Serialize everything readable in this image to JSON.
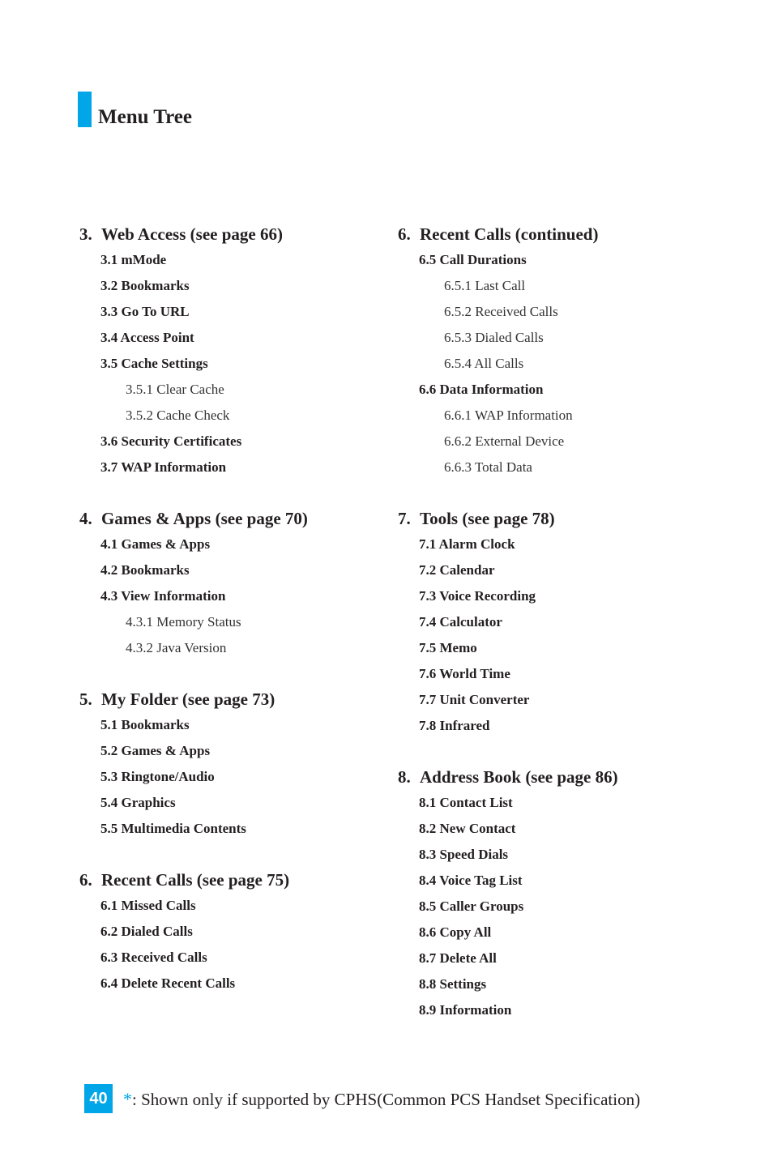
{
  "header": {
    "title": "Menu Tree",
    "accent_color": "#00a6e8"
  },
  "columns": [
    {
      "sections": [
        {
          "num": "3.",
          "label": "Web Access (see page 66)",
          "items": [
            {
              "level": 2,
              "label": "3.1 mMode"
            },
            {
              "level": 2,
              "label": "3.2 Bookmarks"
            },
            {
              "level": 2,
              "label": "3.3 Go To URL"
            },
            {
              "level": 2,
              "label": "3.4 Access Point"
            },
            {
              "level": 2,
              "label": "3.5 Cache Settings"
            },
            {
              "level": 3,
              "label": "3.5.1 Clear Cache"
            },
            {
              "level": 3,
              "label": "3.5.2 Cache Check"
            },
            {
              "level": 2,
              "label": "3.6 Security Certificates"
            },
            {
              "level": 2,
              "label": "3.7 WAP Information"
            }
          ]
        },
        {
          "num": "4.",
          "label": "Games & Apps (see page 70)",
          "items": [
            {
              "level": 2,
              "label": "4.1 Games & Apps"
            },
            {
              "level": 2,
              "label": "4.2 Bookmarks"
            },
            {
              "level": 2,
              "label": "4.3 View Information"
            },
            {
              "level": 3,
              "label": "4.3.1 Memory Status"
            },
            {
              "level": 3,
              "label": "4.3.2 Java Version"
            }
          ]
        },
        {
          "num": "5.",
          "label": "My Folder (see page 73)",
          "items": [
            {
              "level": 2,
              "label": "5.1 Bookmarks"
            },
            {
              "level": 2,
              "label": "5.2 Games & Apps"
            },
            {
              "level": 2,
              "label": "5.3 Ringtone/Audio"
            },
            {
              "level": 2,
              "label": "5.4 Graphics"
            },
            {
              "level": 2,
              "label": "5.5 Multimedia Contents"
            }
          ]
        },
        {
          "num": "6.",
          "label": "Recent Calls (see page 75)",
          "items": [
            {
              "level": 2,
              "label": "6.1 Missed Calls"
            },
            {
              "level": 2,
              "label": "6.2 Dialed Calls"
            },
            {
              "level": 2,
              "label": "6.3 Received Calls"
            },
            {
              "level": 2,
              "label": "6.4 Delete Recent Calls"
            }
          ]
        }
      ]
    },
    {
      "sections": [
        {
          "num": "6.",
          "label": "Recent Calls (continued)",
          "items": [
            {
              "level": 2,
              "label": "6.5 Call Durations"
            },
            {
              "level": 3,
              "label": "6.5.1 Last Call"
            },
            {
              "level": 3,
              "label": "6.5.2 Received Calls"
            },
            {
              "level": 3,
              "label": "6.5.3 Dialed Calls"
            },
            {
              "level": 3,
              "label": "6.5.4 All Calls"
            },
            {
              "level": 2,
              "label": "6.6 Data Information"
            },
            {
              "level": 3,
              "label": "6.6.1 WAP Information"
            },
            {
              "level": 3,
              "label": "6.6.2 External Device"
            },
            {
              "level": 3,
              "label": "6.6.3 Total Data"
            }
          ]
        },
        {
          "num": "7.",
          "label": "Tools (see page 78)",
          "items": [
            {
              "level": 2,
              "label": "7.1 Alarm Clock"
            },
            {
              "level": 2,
              "label": "7.2 Calendar"
            },
            {
              "level": 2,
              "label": "7.3 Voice Recording"
            },
            {
              "level": 2,
              "label": "7.4 Calculator"
            },
            {
              "level": 2,
              "label": "7.5 Memo"
            },
            {
              "level": 2,
              "label": "7.6 World Time"
            },
            {
              "level": 2,
              "label": "7.7 Unit Converter"
            },
            {
              "level": 2,
              "label": "7.8 Infrared"
            }
          ]
        },
        {
          "num": "8.",
          "label": "Address Book (see page 86)",
          "items": [
            {
              "level": 2,
              "label": "8.1 Contact List"
            },
            {
              "level": 2,
              "label": "8.2 New Contact"
            },
            {
              "level": 2,
              "label": "8.3 Speed Dials"
            },
            {
              "level": 2,
              "label": "8.4 Voice Tag List"
            },
            {
              "level": 2,
              "label": "8.5 Caller Groups"
            },
            {
              "level": 2,
              "label": "8.6 Copy All"
            },
            {
              "level": 2,
              "label": "8.7 Delete All"
            },
            {
              "level": 2,
              "label": "8.8 Settings"
            },
            {
              "level": 2,
              "label": "8.9 Information"
            }
          ]
        }
      ]
    }
  ],
  "footer": {
    "page_number": "40",
    "footnote_symbol": "*",
    "footnote_text": ": Shown only if supported by CPHS(Common PCS Handset Specification)"
  }
}
